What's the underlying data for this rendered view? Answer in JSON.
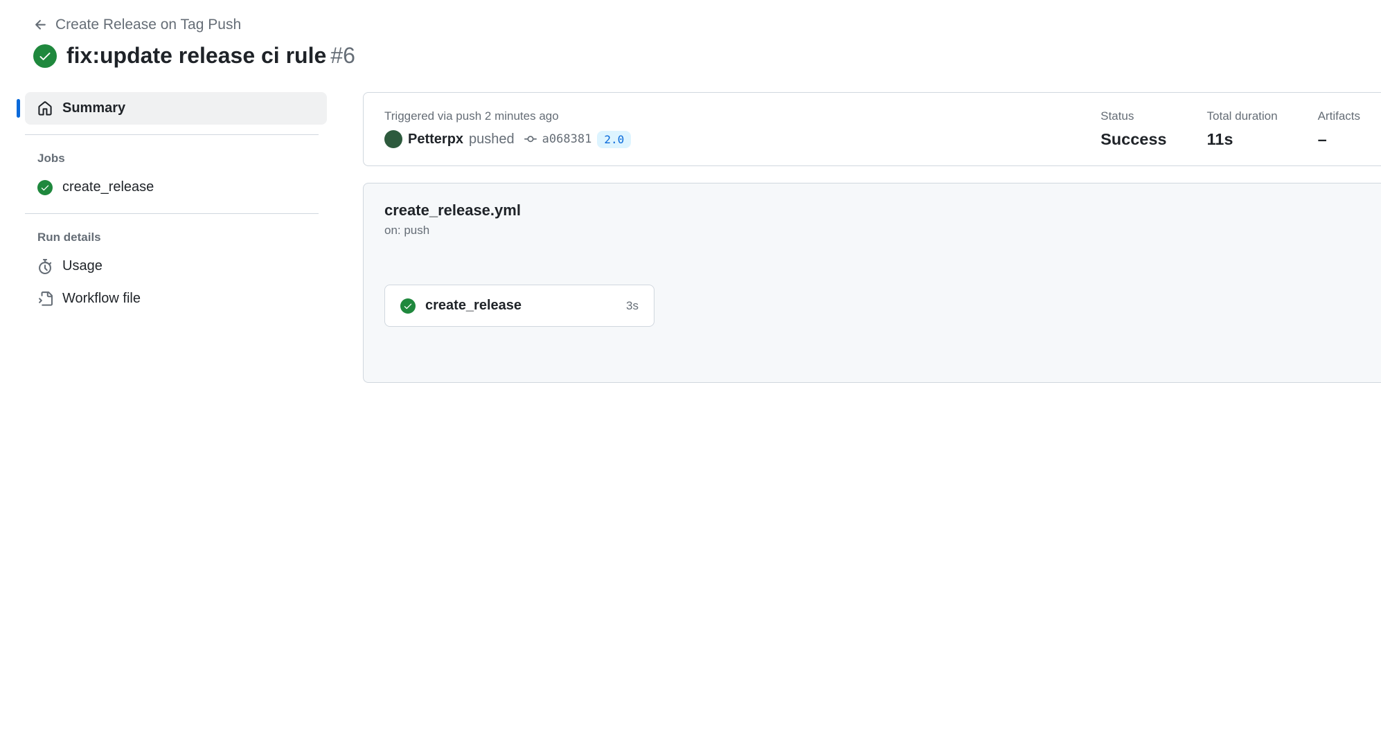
{
  "breadcrumb": {
    "workflow_name": "Create Release on Tag Push"
  },
  "header": {
    "title": "fix:update release ci rule",
    "run_number": "#6",
    "status": "success"
  },
  "sidebar": {
    "summary_label": "Summary",
    "jobs_header": "Jobs",
    "jobs": [
      {
        "name": "create_release",
        "status": "success"
      }
    ],
    "run_details_header": "Run details",
    "usage_label": "Usage",
    "workflow_file_label": "Workflow file"
  },
  "summary": {
    "trigger_line": "Triggered via push 2 minutes ago",
    "actor": "Petterpx",
    "action": "pushed",
    "commit_sha": "a068381",
    "ref_tag": "2.0",
    "status_label": "Status",
    "status_value": "Success",
    "duration_label": "Total duration",
    "duration_value": "11s",
    "artifacts_label": "Artifacts",
    "artifacts_value": "–"
  },
  "graph": {
    "workflow_file": "create_release.yml",
    "trigger": "on: push",
    "jobs": [
      {
        "name": "create_release",
        "duration": "3s",
        "status": "success"
      }
    ]
  }
}
